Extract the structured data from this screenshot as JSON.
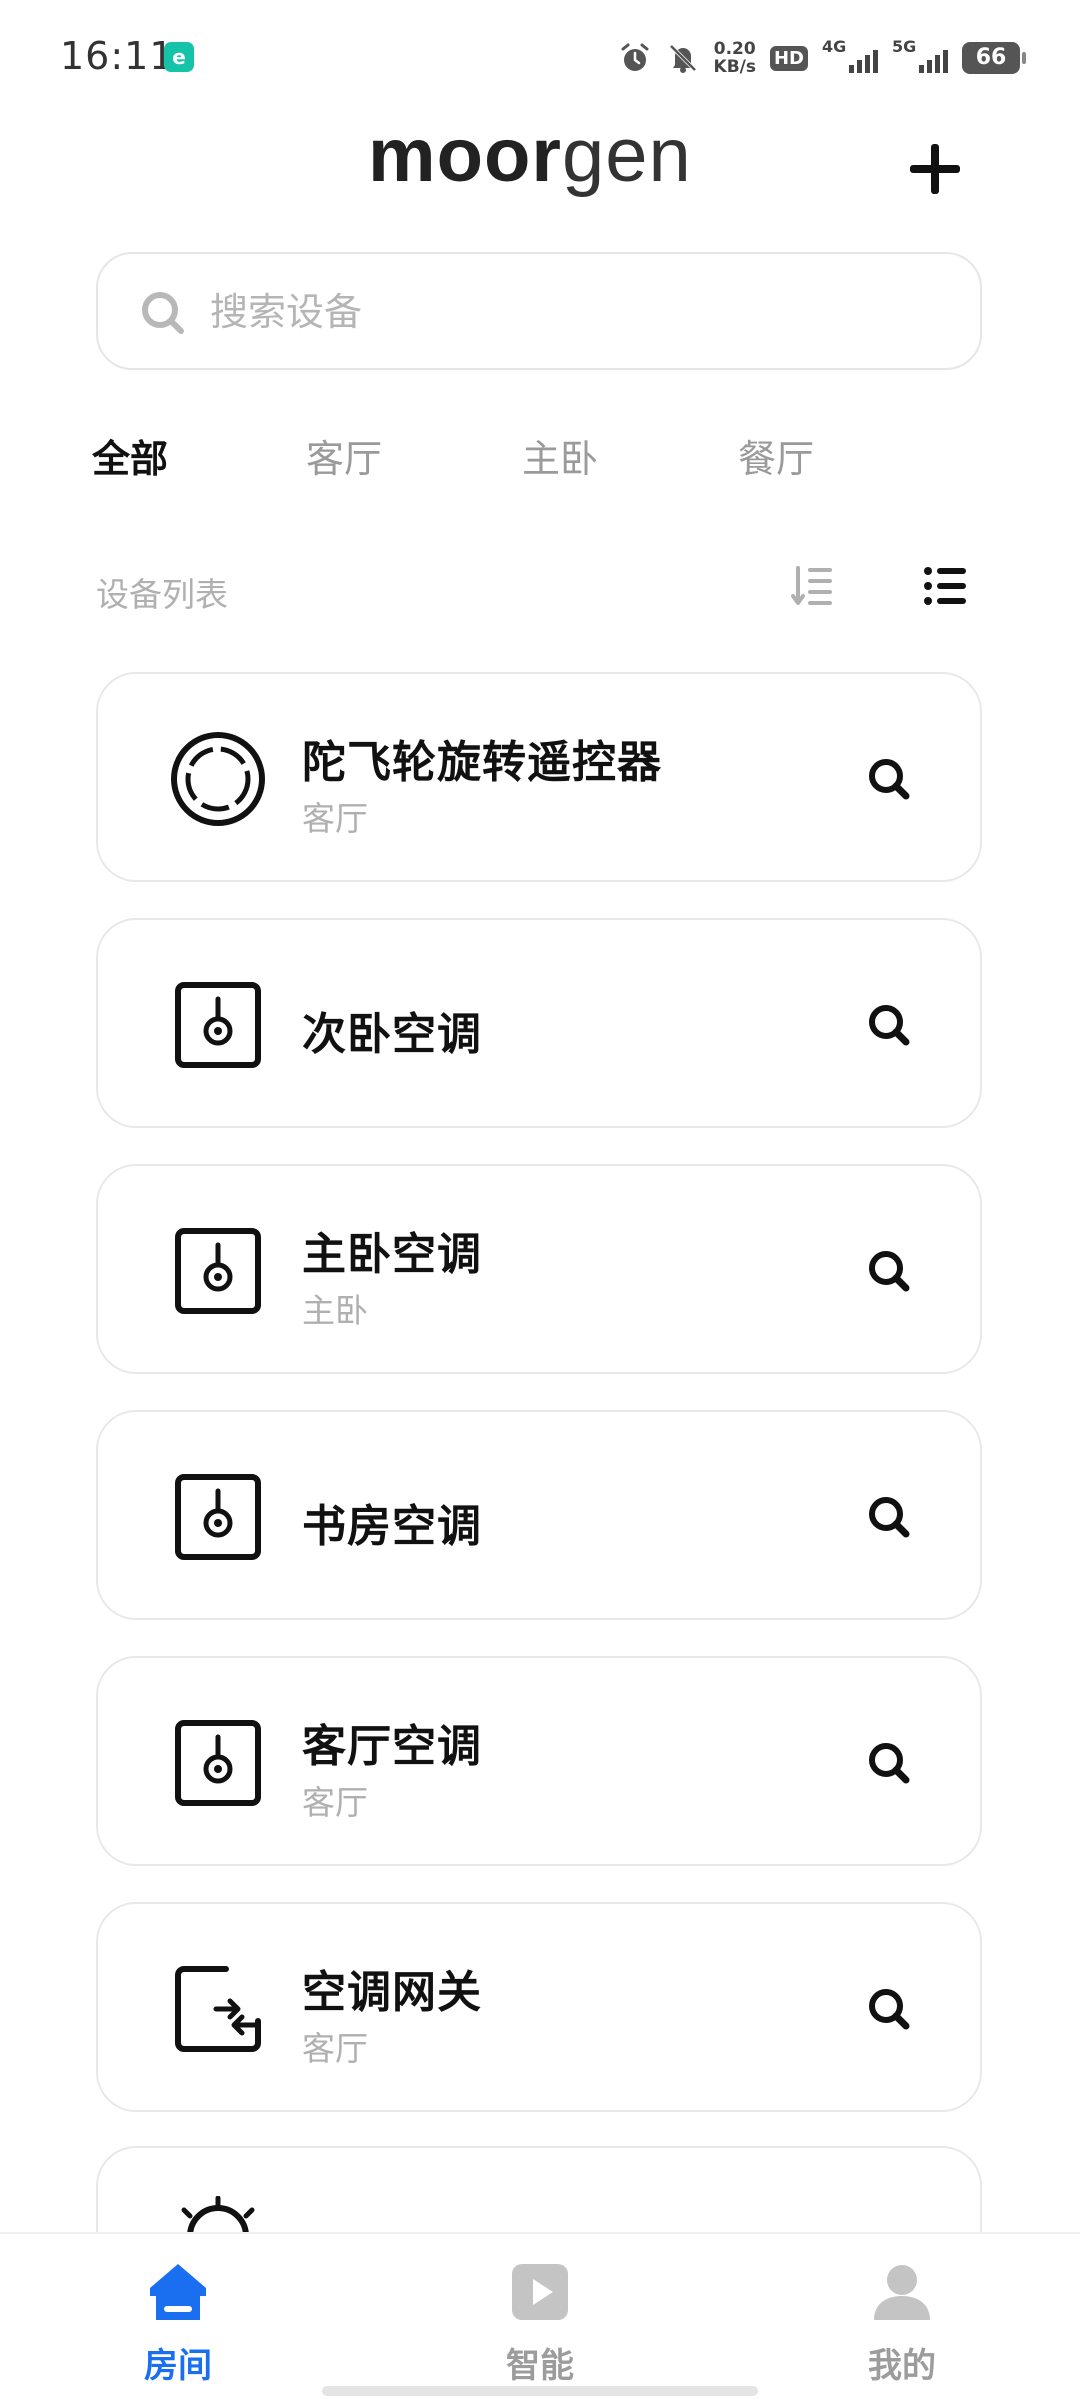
{
  "status_bar": {
    "time": "16:11",
    "net_speed_value": "0.20",
    "net_speed_unit": "KB/s",
    "hd_label": "HD",
    "sim1_label": "4G",
    "sim2_label": "5G",
    "battery": "66",
    "icons": [
      "alarm-icon",
      "mute-bell-icon"
    ]
  },
  "header": {
    "logo_bold": "moor",
    "logo_light": "gen",
    "add_icon": "plus-icon"
  },
  "search": {
    "placeholder": "搜索设备"
  },
  "tabs": [
    {
      "label": "全部",
      "active": true
    },
    {
      "label": "客厅",
      "active": false
    },
    {
      "label": "主卧",
      "active": false
    },
    {
      "label": "餐厅",
      "active": false
    }
  ],
  "list_header": {
    "title": "设备列表"
  },
  "devices": [
    {
      "name": "陀飞轮旋转遥控器",
      "room": "客厅",
      "icon": "rotary-remote-icon"
    },
    {
      "name": "次卧空调",
      "room": "",
      "icon": "ac-icon"
    },
    {
      "name": "主卧空调",
      "room": "主卧",
      "icon": "ac-icon"
    },
    {
      "name": "书房空调",
      "room": "",
      "icon": "ac-icon"
    },
    {
      "name": "客厅空调",
      "room": "客厅",
      "icon": "ac-icon"
    },
    {
      "name": "空调网关",
      "room": "客厅",
      "icon": "gateway-icon"
    },
    {
      "name": "",
      "room": "",
      "icon": "light-icon"
    }
  ],
  "bottom_nav": [
    {
      "label": "房间",
      "icon": "home-icon",
      "active": true
    },
    {
      "label": "智能",
      "icon": "play-icon",
      "active": false
    },
    {
      "label": "我的",
      "icon": "user-icon",
      "active": false
    }
  ],
  "colors": {
    "accent": "#1a6ff0",
    "muted_text": "#b0b0b0",
    "card_border": "#e8e8e8"
  }
}
